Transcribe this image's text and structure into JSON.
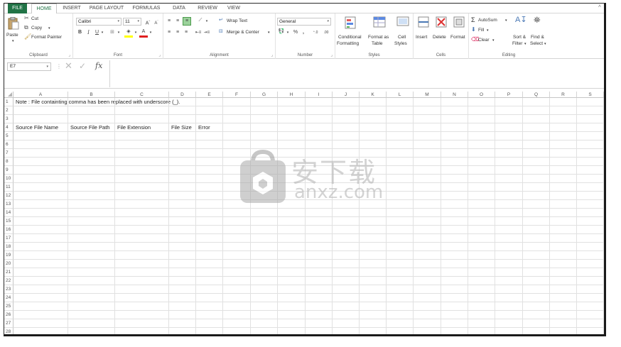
{
  "tabs": [
    "FILE",
    "HOME",
    "INSERT",
    "PAGE LAYOUT",
    "FORMULAS",
    "DATA",
    "REVIEW",
    "VIEW"
  ],
  "ribbon": {
    "clipboard": {
      "paste": "Paste",
      "cut": "Cut",
      "copy": "Copy",
      "format_painter": "Format Painter",
      "label": "Clipboard"
    },
    "font": {
      "name": "Calibri",
      "size": "11",
      "label": "Font",
      "bold": "B",
      "italic": "I",
      "underline": "U"
    },
    "alignment": {
      "wrap_text": "Wrap Text",
      "merge_center": "Merge & Center",
      "label": "Alignment"
    },
    "number": {
      "format": "General",
      "percent": "%",
      "comma": ",",
      "label": "Number"
    },
    "styles": {
      "conditional": "Conditional",
      "conditional2": "Formatting",
      "format_as": "Format as",
      "format_as2": "Table",
      "cell": "Cell",
      "cell2": "Styles",
      "label": "Styles"
    },
    "cells": {
      "insert": "Insert",
      "delete": "Delete",
      "format": "Format",
      "label": "Cells"
    },
    "editing": {
      "autosum": "AutoSum",
      "fill": "Fill",
      "clear": "Clear",
      "sort": "Sort &",
      "sort2": "Filter",
      "find": "Find &",
      "find2": "Select",
      "label": "Editing"
    }
  },
  "formula_bar": {
    "namebox": "E7",
    "fx": "fx"
  },
  "columns": [
    "A",
    "B",
    "C",
    "D",
    "E",
    "F",
    "G",
    "H",
    "I",
    "J",
    "K",
    "L",
    "M",
    "N",
    "O",
    "P",
    "Q",
    "R",
    "S"
  ],
  "rows": [
    "1",
    "2",
    "3",
    "4",
    "5",
    "6",
    "7",
    "8",
    "9",
    "10",
    "11",
    "12",
    "13",
    "14",
    "15",
    "16",
    "17",
    "18",
    "19",
    "20",
    "21",
    "22",
    "23",
    "24",
    "25",
    "26",
    "27",
    "28"
  ],
  "cells": {
    "note": "Note : File containting comma has been replaced with underscore (_).",
    "h_a": "Source File Name",
    "h_b": "Source File Path",
    "h_c": "File Extension",
    "h_d": "File Size",
    "h_e": "Error"
  },
  "watermark": {
    "cn": "安下载",
    "url": "anxz.com"
  }
}
